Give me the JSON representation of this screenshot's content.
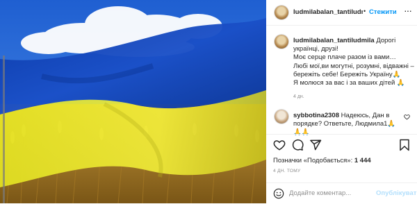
{
  "post": {
    "author": "ludmilabalan_tantiludmila",
    "follow_label": "Стежити",
    "more_icon": "more-horizontal-icon",
    "caption": {
      "lines": [
        "Дорогі українці, друзі!",
        "Моє серце плаче разом із вами…",
        "Любі мої,ви могутні, розумні, відважні – бережіть себе! Бережіть Україну🙏",
        "Я молюся за вас і за ваших дітей 🙏"
      ],
      "time": "4 дн."
    },
    "comment": {
      "author": "sybbotina2308",
      "text": "Надеюсь, Дан в порядке? Ответьте, Людмила1🙏🙏🙏"
    },
    "likes": {
      "label": "Позначки «Подобається»:",
      "count": "1 444"
    },
    "posted": "4 ДН. ТОМУ"
  },
  "comment_input": {
    "placeholder": "Додайте коментар...",
    "publish_label": "Опублікувати"
  },
  "icons": [
    "heart-icon",
    "comment-icon",
    "share-icon",
    "bookmark-icon",
    "emoji-icon"
  ],
  "colors": {
    "link_blue": "#0095f6",
    "publish_disabled": "#b2dffc",
    "muted": "#8e8e8e"
  }
}
